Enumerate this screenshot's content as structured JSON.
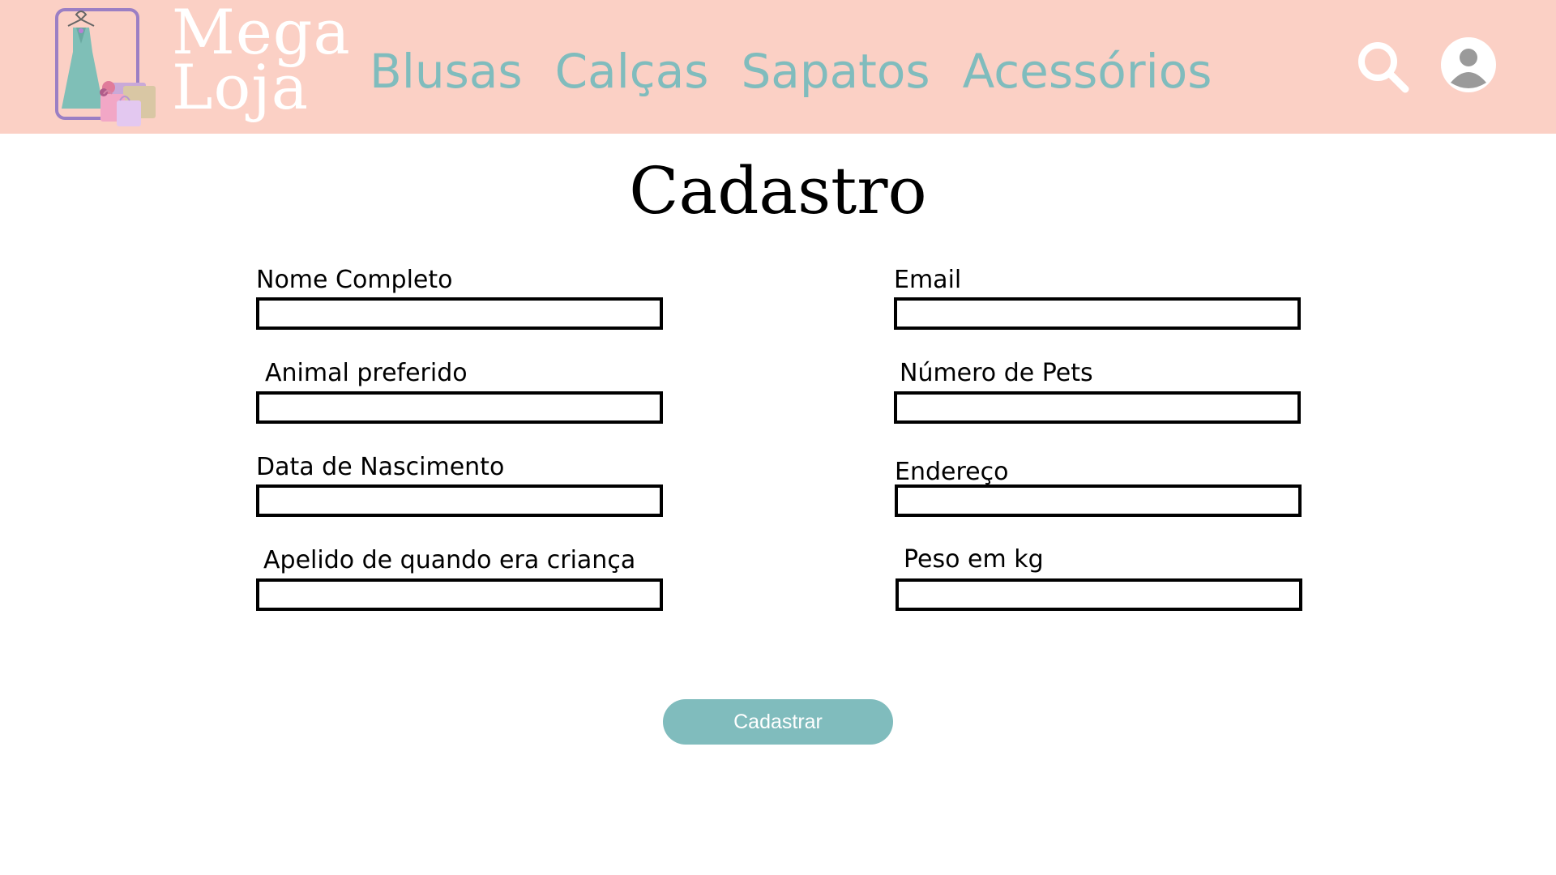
{
  "brand": {
    "line1": "Mega",
    "line2": "Loja"
  },
  "nav": {
    "items": [
      {
        "label": "Blusas"
      },
      {
        "label": "Calças"
      },
      {
        "label": "Sapatos"
      },
      {
        "label": "Acessórios"
      }
    ]
  },
  "header_icons": {
    "search": "search-icon",
    "account": "user-avatar-icon"
  },
  "page": {
    "title": "Cadastro"
  },
  "form": {
    "fields": [
      {
        "label": "Nome Completo",
        "value": "",
        "placeholder": ""
      },
      {
        "label": "Email",
        "value": "",
        "placeholder": ""
      },
      {
        "label": "Animal preferido",
        "value": "",
        "placeholder": ""
      },
      {
        "label": "Número de Pets",
        "value": "",
        "placeholder": ""
      },
      {
        "label": "Data de Nascimento",
        "value": "",
        "placeholder": ""
      },
      {
        "label": "Endereço",
        "value": "",
        "placeholder": ""
      },
      {
        "label": "Apelido de quando era criança",
        "value": "",
        "placeholder": ""
      },
      {
        "label": "Peso em kg",
        "value": "",
        "placeholder": ""
      }
    ],
    "submit_label": "Cadastrar"
  },
  "colors": {
    "header_bg": "#fbd0c5",
    "accent": "#80bcbd",
    "brand_text": "#ffffff"
  }
}
